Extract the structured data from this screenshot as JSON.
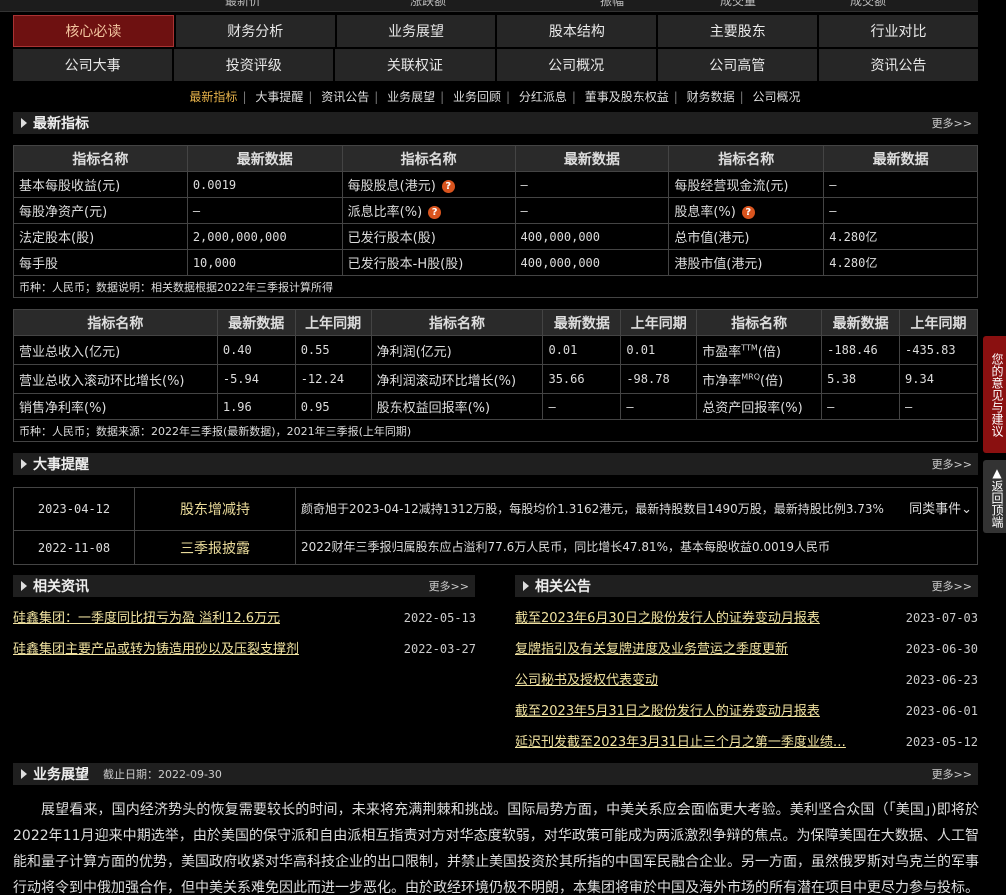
{
  "topbar": {
    "items": [
      "最新价",
      "涨跌额",
      "振幅",
      "成交量",
      "成交额"
    ]
  },
  "nav": {
    "row1": [
      "核心必读",
      "财务分析",
      "业务展望",
      "股本结构",
      "主要股东",
      "行业对比"
    ],
    "row2": [
      "公司大事",
      "投资评级",
      "关联权证",
      "公司概况",
      "公司高管",
      "资讯公告"
    ]
  },
  "subnav": [
    "最新指标",
    "大事提醒",
    "资讯公告",
    "业务展望",
    "业务回顾",
    "分红派息",
    "董事及股东权益",
    "财务数据",
    "公司概况"
  ],
  "more_label": "更多>>",
  "indicators": {
    "title": "最新指标",
    "headers": [
      "指标名称",
      "最新数据",
      "指标名称",
      "最新数据",
      "指标名称",
      "最新数据"
    ],
    "rows": [
      [
        "基本每股收益(元)",
        "0.0019",
        "每股股息(港元)",
        "—",
        "每股经营现金流(元)",
        "—"
      ],
      [
        "每股净资产(元)",
        "—",
        "派息比率(%)",
        "—",
        "股息率(%)",
        "—"
      ],
      [
        "法定股本(股)",
        "2,000,000,000",
        "已发行股本(股)",
        "400,000,000",
        "总市值(港元)",
        "4.280亿"
      ],
      [
        "每手股",
        "10,000",
        "已发行股本-H股(股)",
        "400,000,000",
        "港股市值(港元)",
        "4.280亿"
      ]
    ],
    "note": "币种：人民币；数据说明：相关数据根据2022年三季报计算所得"
  },
  "finance": {
    "headers": [
      "指标名称",
      "最新数据",
      "上年同期",
      "指标名称",
      "最新数据",
      "上年同期",
      "指标名称",
      "最新数据",
      "上年同期"
    ],
    "rows": [
      [
        "营业总收入(亿元)",
        "0.40",
        "0.55",
        "净利润(亿元)",
        "0.01",
        "0.01",
        "市盈率",
        "-188.46",
        "-435.83"
      ],
      [
        "营业总收入滚动环比增长(%)",
        "-5.94",
        "-12.24",
        "净利润滚动环比增长(%)",
        "35.66",
        "-98.78",
        "市净率",
        "5.38",
        "9.34"
      ],
      [
        "销售净利率(%)",
        "1.96",
        "0.95",
        "股东权益回报率(%)",
        "—",
        "—",
        "总资产回报率(%)",
        "—",
        "—"
      ]
    ],
    "pe_sup": "TTM",
    "pe_suffix": "(倍)",
    "pb_sup": "MRQ",
    "pb_suffix": "(倍)",
    "note": "币种：人民币；数据来源：2022年三季报(最新数据)，2021年三季报(上年同期)"
  },
  "events": {
    "title": "大事提醒",
    "similar_label": "同类事件",
    "rows": [
      {
        "date": "2023-04-12",
        "type": "股东增减持",
        "text": "颜奇旭于2023-04-12减持1312万股，每股均价1.3162港元，最新持股数目1490万股，最新持股比例3.73%"
      },
      {
        "date": "2022-11-08",
        "type": "三季报披露",
        "text": "2022财年三季报归属股东应占溢利77.6万人民币，同比增长47.81%，基本每股收益0.0019人民币"
      }
    ]
  },
  "news": {
    "title": "相关资讯",
    "items": [
      {
        "title": "硅鑫集团：一季度同比扭亏为盈 溢利12.6万元",
        "date": "2022-05-13"
      },
      {
        "title": "硅鑫集团主要产品或转为铸造用砂以及压裂支撑剂",
        "date": "2022-03-27"
      }
    ]
  },
  "notices": {
    "title": "相关公告",
    "items": [
      {
        "title": "截至2023年6月30日之股份发行人的证券变动月报表",
        "date": "2023-07-03"
      },
      {
        "title": "复牌指引及有关复牌进度及业务营运之季度更新",
        "date": "2023-06-30"
      },
      {
        "title": "公司秘书及授权代表变动",
        "date": "2023-06-23"
      },
      {
        "title": "截至2023年5月31日之股份发行人的证券变动月报表",
        "date": "2023-06-01"
      },
      {
        "title": "延迟刊发截至2023年3月31日止三个月之第一季度业绩…",
        "date": "2023-05-12"
      }
    ]
  },
  "outlook": {
    "title": "业务展望",
    "date": "截止日期：2022-09-30",
    "text": "展望看来，国内经济势头的恢复需要较长的时间，未来将充满荆棘和挑战。国际局势方面，中美关系应会面临更大考验。美利坚合众国（「美国」)即将於2022年11月迎来中期选举，由於美国的保守派和自由派相互指责对方对华态度软弱，对华政策可能成为两派激烈争辩的焦点。为保障美国在大数据、人工智能和量子计算方面的优势，美国政府收紧对华高科技企业的出口限制，并禁止美国投资於其所指的中国军民融合企业。另一方面，虽然俄罗斯对乌克兰的军事行动将令到中俄加强合作，但中美关系难免因此而进一步恶化。由於政经环境仍极不明朗，本集团将审於中国及海外市场的所有潜在项目中更尽力参与投标。此外，本集"
  },
  "side": {
    "feedback": "您的意见与建议",
    "totop": "返回顶端"
  }
}
